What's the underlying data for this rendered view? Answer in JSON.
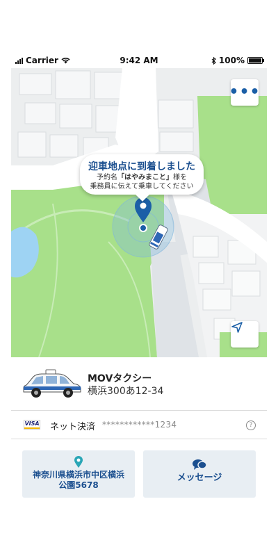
{
  "status_bar": {
    "carrier": "Carrier",
    "time": "9:42 AM",
    "battery": "100%"
  },
  "map": {
    "menu_label": "•••",
    "bubble": {
      "title": "迎車地点に到着しました",
      "line1_prefix": "予約名",
      "line1_name": "「はやみまこと」",
      "line1_suffix": "様を",
      "line2": "乗務員に伝えて乗車してください"
    }
  },
  "car": {
    "name": "MOVタクシー",
    "plate": "横浜300あ12-34"
  },
  "payment": {
    "card_brand": "VISA",
    "method": "ネット決済",
    "card_number": "************1234",
    "help": "?"
  },
  "actions": {
    "pickup_location": "神奈川県横浜市中区横浜\n公園5678",
    "pickup_line1": "神奈川県横浜市中区横浜",
    "pickup_line2": "公園5678",
    "message": "メッセージ"
  },
  "colors": {
    "accent": "#1b4f8f",
    "park_green": "#a8e08a",
    "water": "#9ed3f3",
    "road": "#ffffff",
    "road_dark": "#dfe3e7"
  }
}
